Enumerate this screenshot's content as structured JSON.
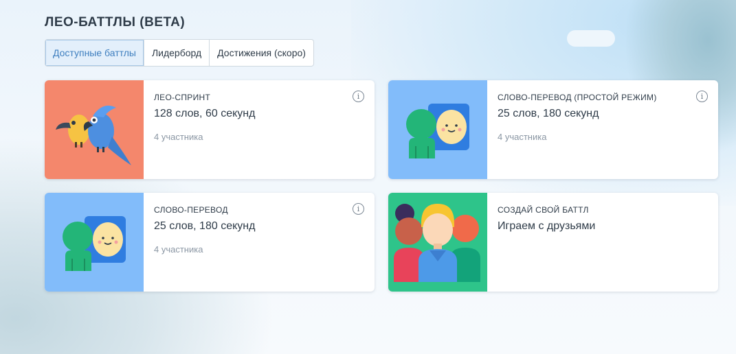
{
  "page_title": "ЛЕО-БАТТЛЫ (BETA)",
  "tabs": [
    {
      "label": "Доступные баттлы",
      "active": true
    },
    {
      "label": "Лидерборд",
      "active": false
    },
    {
      "label": "Достижения (скоро)",
      "active": false
    }
  ],
  "cards": [
    {
      "label": "ЛЕО-СПРИНТ",
      "title": "128 слов, 60 секунд",
      "meta": "4 участника",
      "thumb_color": "#f4876c",
      "icon": "parrots-icon"
    },
    {
      "label": "СЛОВО-ПЕРЕВОД (ПРОСТОЙ РЕЖИМ)",
      "title": "25 слов, 180 секунд",
      "meta": "4 участника",
      "thumb_color": "#82bcfa",
      "icon": "translation-people-icon"
    },
    {
      "label": "СЛОВО-ПЕРЕВОД",
      "title": "25 слов, 180 секунд",
      "meta": "4 участника",
      "thumb_color": "#82bcfa",
      "icon": "translation-people-icon"
    },
    {
      "label": "СОЗДАЙ СВОЙ БАТТЛ",
      "title": "Играем с друзьями",
      "meta": "",
      "thumb_color": "#2ec48a",
      "icon": "friends-group-icon"
    }
  ],
  "info_icon_glyph": "i"
}
